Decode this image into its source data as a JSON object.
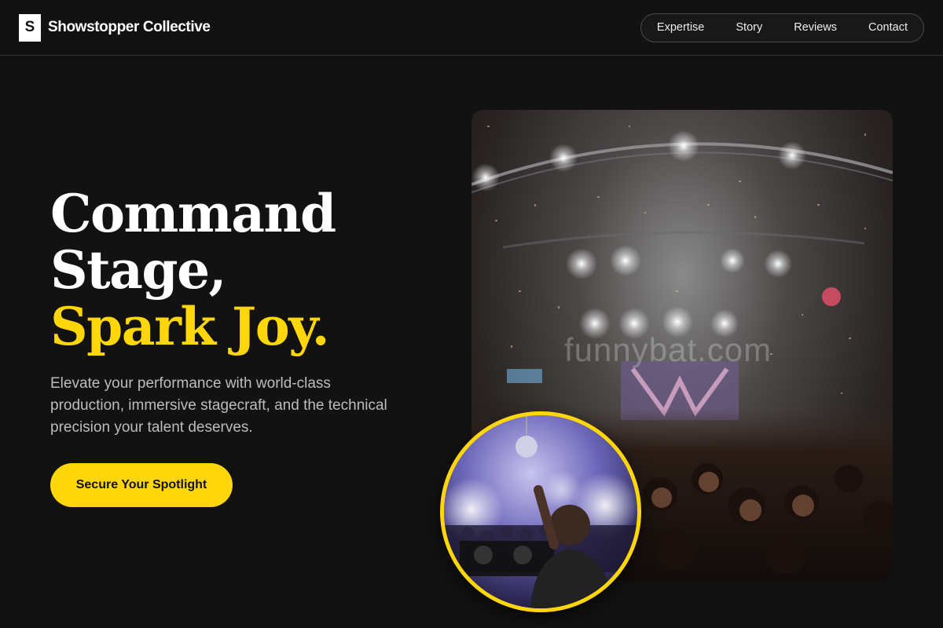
{
  "brand": {
    "logo_letter": "S",
    "name": "Showstopper Collective"
  },
  "nav": {
    "items": [
      "Expertise",
      "Story",
      "Reviews",
      "Contact"
    ]
  },
  "hero": {
    "title_line1": "Command",
    "title_line2": "Stage,",
    "title_accent": "Spark Joy.",
    "subtitle": "Elevate your performance with world-class production, immersive stagecraft, and the technical precision your talent deserves.",
    "cta_label": "Secure Your Spotlight"
  },
  "images": {
    "main_watermark": "funnybat.com",
    "main_alt": "Concert stage with lights, confetti and crowd",
    "inset_alt": "DJ performing at a club with disco ball"
  },
  "colors": {
    "background": "#121212",
    "accent": "#ffd60a",
    "text": "#ffffff",
    "muted_text": "#bdbdbd"
  }
}
